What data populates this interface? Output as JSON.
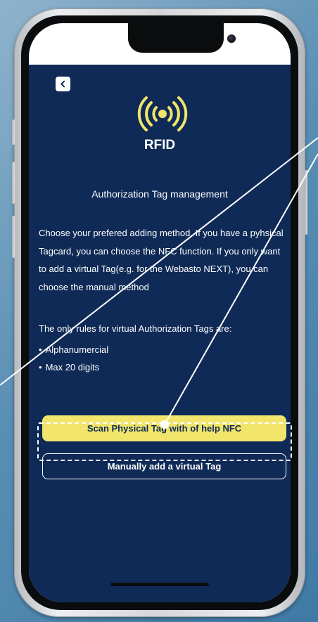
{
  "colors": {
    "app_background": "#0f2a56",
    "accent_yellow": "#f1e56c",
    "text": "#ffffff",
    "device_frame": "#d4d6d9"
  },
  "header": {
    "back_icon": "chevron-left-icon",
    "logo_icon": "rfid-broadcast-icon",
    "logo_text": "RFID"
  },
  "main": {
    "subtitle": "Authorization Tag management",
    "description": "Choose your prefered adding method. If you have a pyhsical Tagcard, you can choose the NFC function. If you only want to add a virtual Tag(e.g. for the Webasto NEXT), you can choose the manual method",
    "rules_title": "The only rules for virtual Authorization Tags are:",
    "rules": [
      "Alphanumercial",
      "Max 20 digits"
    ]
  },
  "actions": {
    "scan_label": "Scan Physical Tag with of help NFC",
    "manual_label": "Manually add a virtual Tag"
  }
}
